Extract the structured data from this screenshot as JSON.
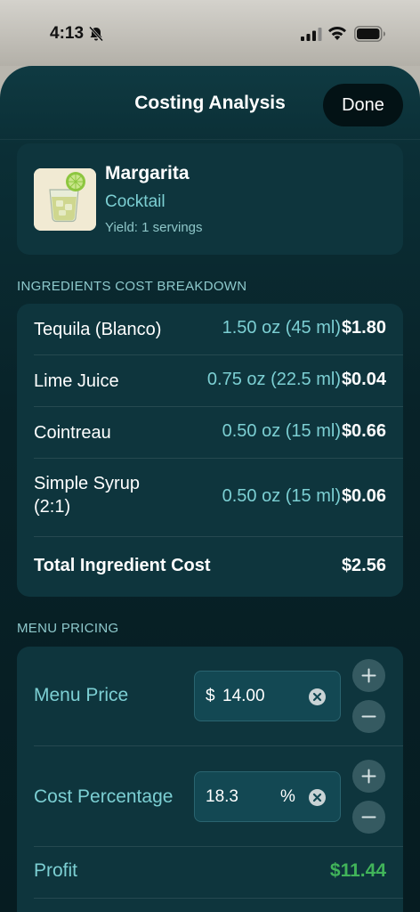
{
  "status_bar": {
    "time": "4:13",
    "icons": [
      "bell-slash-icon",
      "cellular-signal-icon",
      "wifi-icon",
      "battery-icon"
    ]
  },
  "nav": {
    "title": "Costing Analysis",
    "done_label": "Done"
  },
  "recipe": {
    "name": "Margarita",
    "type": "Cocktail",
    "yield": "Yield: 1 servings",
    "thumbnail_icon": "margarita-glass-icon"
  },
  "ingredients": {
    "section_title": "INGREDIENTS COST BREAKDOWN",
    "items": [
      {
        "name": "Tequila (Blanco)",
        "quantity": "1.50 oz (45 ml)",
        "cost": "$1.80"
      },
      {
        "name": "Lime Juice",
        "quantity": "0.75 oz (22.5 ml)",
        "cost": "$0.04"
      },
      {
        "name": "Cointreau",
        "quantity": "0.50 oz (15 ml)",
        "cost": "$0.66"
      },
      {
        "name": "Simple Syrup (2:1)",
        "name_line1": "Simple Syrup",
        "name_line2": "(2:1)",
        "quantity": "0.50 oz (15 ml)",
        "cost": "$0.06"
      }
    ],
    "total_label": "Total Ingredient Cost",
    "total_value": "$2.56"
  },
  "pricing": {
    "section_title": "MENU PRICING",
    "menu_price": {
      "label": "Menu Price",
      "prefix": "$",
      "value": "14.00"
    },
    "cost_percentage": {
      "label": "Cost Percentage",
      "value": "18.3",
      "suffix": "%"
    },
    "profit": {
      "label": "Profit",
      "value": "$11.44"
    }
  },
  "colors": {
    "accent": "#7ccfd3",
    "profit": "#41b45a",
    "sheet_background": "#0b2f36",
    "card_background": "#0e353d"
  }
}
